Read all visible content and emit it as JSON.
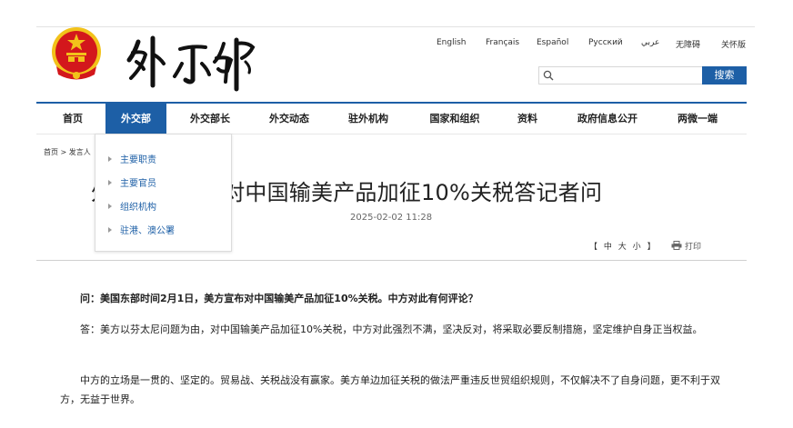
{
  "site": {
    "name": "外交部"
  },
  "languages": [
    "English",
    "Français",
    "Español",
    "Русский",
    "عربي",
    "无障碍",
    "关怀版"
  ],
  "search": {
    "placeholder": "",
    "button_label": "搜索"
  },
  "nav": {
    "items": [
      "首页",
      "外交部",
      "外交部长",
      "外交动态",
      "驻外机构",
      "国家和组织",
      "资料",
      "政府信息公开",
      "两微一端"
    ],
    "active_index": 1
  },
  "dropdown": {
    "items": [
      "主要职责",
      "主要官员",
      "组织机构",
      "驻港、澳公署"
    ]
  },
  "breadcrumb": {
    "home": "首页",
    "sep": ">",
    "current": "发言人"
  },
  "article": {
    "title_prefix": "外",
    "title": "就美方宣布对中国输美产品加征10%关税答记者问",
    "date": "2025-02-02 11:28",
    "font_size": {
      "open": "【",
      "large": "中",
      "medium": "大",
      "small": "小",
      "close": "】"
    },
    "print_label": "打印",
    "question": "问：美国东部时间2月1日，美方宣布对中国输美产品加征10%关税。中方对此有何评论？",
    "answer": "答：美方以芬太尼问题为由，对中国输美产品加征10%关税，中方对此强烈不满，坚决反对，将采取必要反制措施，坚定维护自身正当权益。",
    "paragraph": "中方的立场是一贯的、坚定的。贸易战、关税战没有赢家。美方单边加征关税的做法严重违反世贸组织规则，不仅解决不了自身问题，更不利于双方，无益于世界。"
  },
  "colors": {
    "brand_blue": "#1d5fa6",
    "emblem_red": "#d3171c",
    "emblem_gold": "#f2c21a"
  },
  "icons": {
    "emblem": "national-emblem-icon",
    "search": "search-icon",
    "print": "print-icon",
    "arrow": "triangle-right-icon"
  }
}
